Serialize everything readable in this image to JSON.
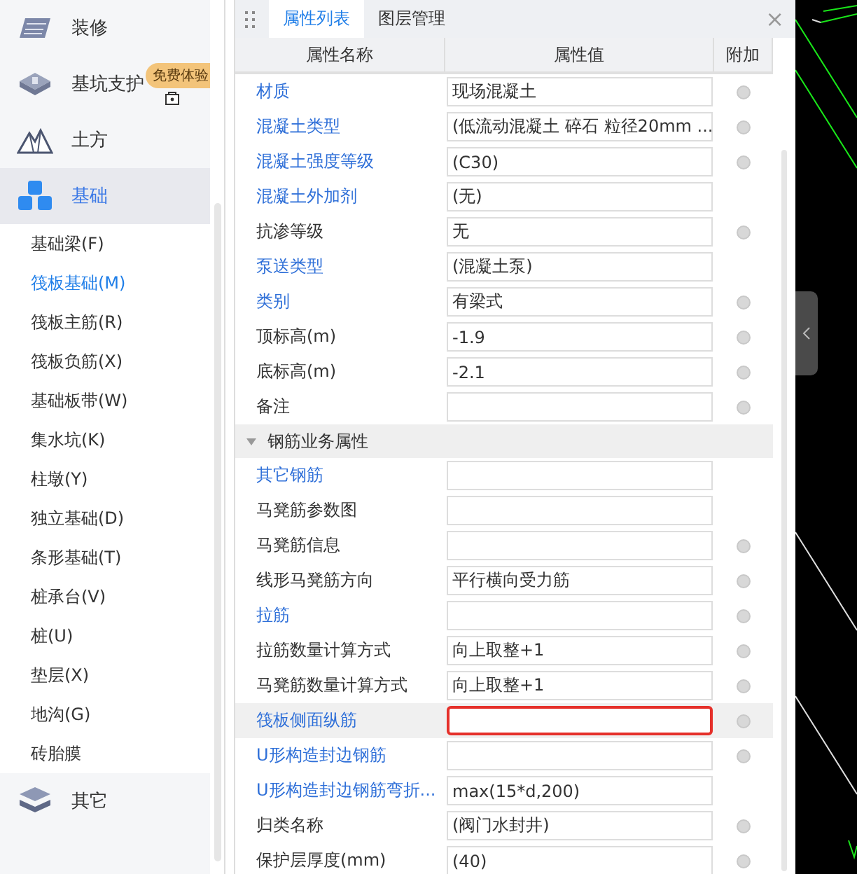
{
  "sidebar": {
    "categories": [
      {
        "label": "装修",
        "kind": "decor",
        "selected": false
      },
      {
        "label": "基坑支护",
        "kind": "pit",
        "selected": false,
        "badge": "免费体验",
        "locked": true
      },
      {
        "label": "土方",
        "kind": "earth",
        "selected": false
      },
      {
        "label": "基础",
        "kind": "foundation",
        "selected": true,
        "expanded": true,
        "children": [
          {
            "label": "基础梁(F)",
            "selected": false
          },
          {
            "label": "筏板基础(M)",
            "selected": true
          },
          {
            "label": "筏板主筋(R)",
            "selected": false
          },
          {
            "label": "筏板负筋(X)",
            "selected": false
          },
          {
            "label": "基础板带(W)",
            "selected": false
          },
          {
            "label": "集水坑(K)",
            "selected": false
          },
          {
            "label": "柱墩(Y)",
            "selected": false
          },
          {
            "label": "独立基础(D)",
            "selected": false
          },
          {
            "label": "条形基础(T)",
            "selected": false
          },
          {
            "label": "桩承台(V)",
            "selected": false
          },
          {
            "label": "桩(U)",
            "selected": false
          },
          {
            "label": "垫层(X)",
            "selected": false
          },
          {
            "label": "地沟(G)",
            "selected": false
          },
          {
            "label": "砖胎膜",
            "selected": false
          }
        ]
      },
      {
        "label": "其它",
        "kind": "layers",
        "selected": false
      }
    ]
  },
  "panel": {
    "tabs": [
      {
        "label": "属性列表",
        "selected": true
      },
      {
        "label": "图层管理",
        "selected": false
      }
    ],
    "close": "×",
    "columns": [
      "属性名称",
      "属性值",
      "附加"
    ],
    "groups": [
      {
        "rows": [
          {
            "name": "材质",
            "value": "现场混凝土",
            "linked": true,
            "extra": true,
            "selected": false
          },
          {
            "name": "混凝土类型",
            "value": "(低流动混凝土 碎石 粒径20mm ...",
            "linked": true,
            "extra": true,
            "selected": false
          },
          {
            "name": "混凝土强度等级",
            "value": "(C30)",
            "linked": true,
            "extra": true,
            "selected": false
          },
          {
            "name": "混凝土外加剂",
            "value": "(无)",
            "linked": true,
            "extra": false,
            "selected": false
          },
          {
            "name": "抗渗等级",
            "value": "无",
            "linked": false,
            "extra": true,
            "selected": false
          },
          {
            "name": "泵送类型",
            "value": "(混凝土泵)",
            "linked": true,
            "extra": false,
            "selected": false
          },
          {
            "name": "类别",
            "value": "有梁式",
            "linked": true,
            "extra": true,
            "selected": false
          },
          {
            "name": "顶标高(m)",
            "value": "-1.9",
            "linked": false,
            "extra": true,
            "selected": false
          },
          {
            "name": "底标高(m)",
            "value": "-2.1",
            "linked": false,
            "extra": true,
            "selected": false
          },
          {
            "name": "备注",
            "value": "",
            "linked": false,
            "extra": true,
            "selected": false
          }
        ]
      },
      {
        "title": "钢筋业务属性",
        "expanded": true,
        "rows": [
          {
            "name": "其它钢筋",
            "value": "",
            "linked": true,
            "extra": false,
            "selected": false
          },
          {
            "name": "马凳筋参数图",
            "value": "",
            "linked": false,
            "extra": false,
            "selected": false
          },
          {
            "name": "马凳筋信息",
            "value": "",
            "linked": false,
            "extra": true,
            "selected": false
          },
          {
            "name": "线形马凳筋方向",
            "value": "平行横向受力筋",
            "linked": false,
            "extra": true,
            "selected": false
          },
          {
            "name": "拉筋",
            "value": "",
            "linked": true,
            "extra": true,
            "selected": false
          },
          {
            "name": "拉筋数量计算方式",
            "value": "向上取整+1",
            "linked": false,
            "extra": true,
            "selected": false
          },
          {
            "name": "马凳筋数量计算方式",
            "value": "向上取整+1",
            "linked": false,
            "extra": true,
            "selected": false
          },
          {
            "name": "筏板侧面纵筋",
            "value": "",
            "linked": true,
            "extra": true,
            "selected": true
          },
          {
            "name": "U形构造封边钢筋",
            "value": "",
            "linked": true,
            "extra": true,
            "selected": false
          },
          {
            "name": "U形构造封边钢筋弯折...",
            "value": "max(15*d,200)",
            "linked": true,
            "extra": false,
            "selected": false
          },
          {
            "name": "归类名称",
            "value": "(阀门水封井)",
            "linked": false,
            "extra": true,
            "selected": false
          },
          {
            "name": "保护层厚度(mm)",
            "value": "(40)",
            "linked": false,
            "extra": true,
            "selected": false
          }
        ]
      }
    ]
  }
}
